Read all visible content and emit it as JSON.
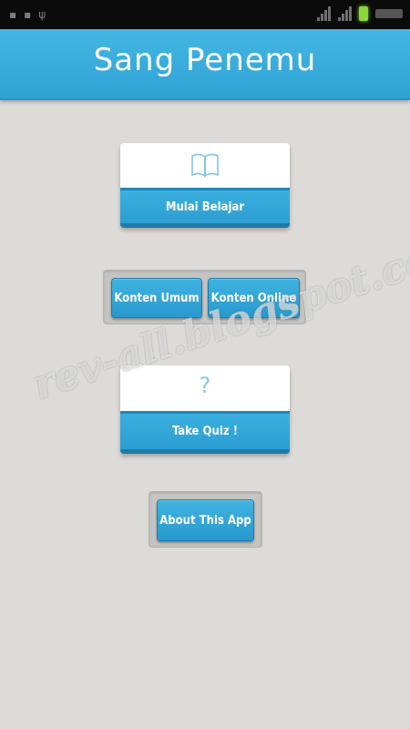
{
  "status_bar": {},
  "header": {
    "title": "Sang Penemu"
  },
  "menu": {
    "mulai_belajar": {
      "label": "Mulai Belajar",
      "icon": "book-icon"
    },
    "konten_umum": {
      "label": "Konten Umum"
    },
    "konten_online": {
      "label": "Konten Online"
    },
    "take_quiz": {
      "label": "Take Quiz !",
      "icon": "question-mark-icon"
    },
    "about": {
      "label": "About This App"
    }
  },
  "watermark": {
    "text": "rev-all.blogspot.com"
  },
  "colors": {
    "accent": "#3aaee0",
    "background": "#dcdbd8",
    "header_text": "#ffffff"
  }
}
